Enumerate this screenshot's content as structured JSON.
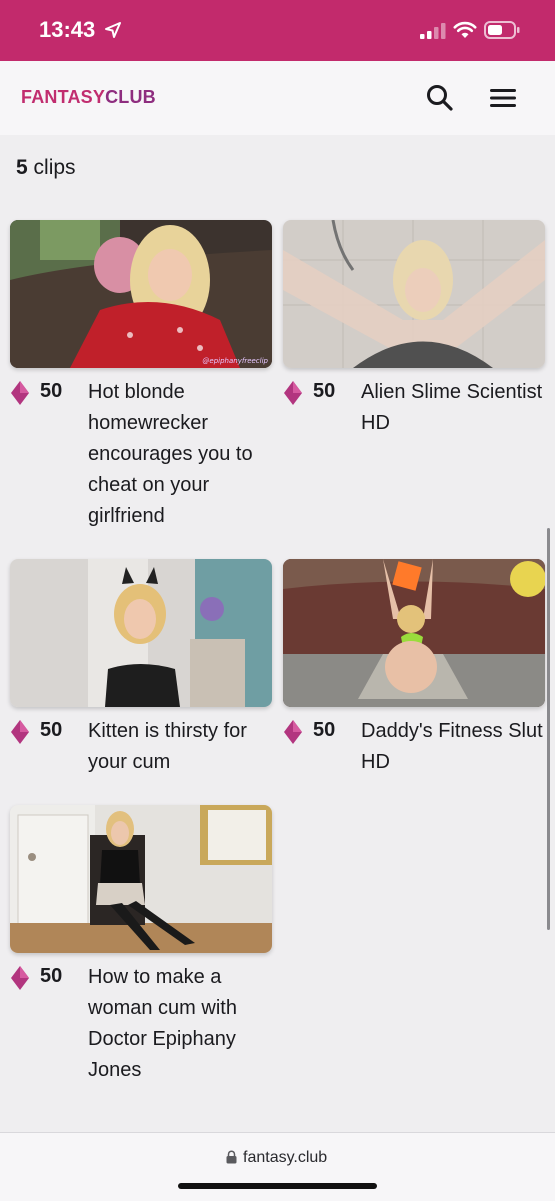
{
  "status_bar": {
    "time": "13:43"
  },
  "header": {
    "logo_part1": "FANTASY",
    "logo_part2": "CLUB",
    "search_icon": "search-icon",
    "menu_icon": "hamburger-menu-icon"
  },
  "clips_count": {
    "number": "5",
    "label": "clips"
  },
  "clips": [
    {
      "price": "50",
      "title": "Hot blonde homewrecker encourages you to cheat on your girlfriend",
      "thumb_caption": "@epiphanyfreeclip"
    },
    {
      "price": "50",
      "title": "Alien Slime Scientist HD"
    },
    {
      "price": "50",
      "title": "Kitten is thirsty for your cum"
    },
    {
      "price": "50",
      "title": "Daddy's Fitness Slut HD"
    },
    {
      "price": "50",
      "title": "How to make a woman cum with Doctor Epiphany Jones"
    }
  ],
  "browser": {
    "url": "fantasy.club"
  },
  "colors": {
    "brand": "#c22a6c",
    "logo_secondary": "#8e2d7f",
    "gem": "#b2357f"
  }
}
